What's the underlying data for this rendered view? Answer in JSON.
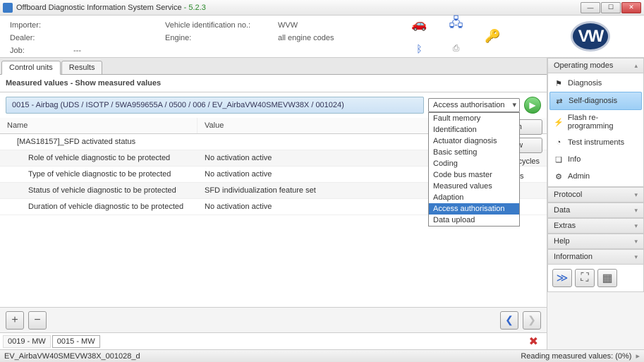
{
  "window": {
    "title": "Offboard Diagnostic Information System Service",
    "version": "- 5.2.3"
  },
  "header": {
    "importer_label": "Importer:",
    "importer_val": "",
    "dealer_label": "Dealer:",
    "dealer_val": "",
    "job_label": "Job:",
    "job_val": "---",
    "vin_label": "Vehicle identification no.:",
    "vin_val": "WVW",
    "engine_label": "Engine:",
    "engine_val": "all engine codes"
  },
  "tabs": {
    "t0": "Control units",
    "t1": "Results"
  },
  "section_title": "Measured values - Show measured values",
  "unit": "0015 - Airbag  (UDS / ISOTP / 5WA959655A / 0500 / 006 / EV_AirbaVW40SMEVW38X / 001024)",
  "dropdown": {
    "selected": "Access authorisation",
    "items": [
      "Fault memory",
      "Identification",
      "Actuator diagnosis",
      "Basic setting",
      "Coding",
      "Code bus master",
      "Measured values",
      "Adaption",
      "Access authorisation",
      "Data upload"
    ]
  },
  "columns": {
    "name": "Name",
    "value": "Value"
  },
  "rows": [
    {
      "name": "[MAS18157]_SFD activated status",
      "value": "",
      "indent": 1
    },
    {
      "name": "Role of vehicle diagnostic to be protected",
      "value": "No activation active",
      "indent": 2
    },
    {
      "name": "Type of vehicle diagnostic to be protected",
      "value": "No activation active",
      "indent": 2
    },
    {
      "name": "Status of vehicle diagnostic to be protected",
      "value": "SFD individualization feature set",
      "indent": 2
    },
    {
      "name": "Duration of vehicle diagnostic to be protected",
      "value": "No activation active",
      "indent": 2
    }
  ],
  "side_controls": {
    "refresh": "sh",
    "now": "ow",
    "cycles": "cycles",
    "cycles_val": "",
    "unit": "s"
  },
  "path": {
    "p0": "0019 - MW",
    "p1": "0015 - MW"
  },
  "status": {
    "left": "EV_AirbaVW40SMEVW38X_001028_d",
    "right": "Reading measured values: (0%)"
  },
  "sidebar": {
    "modes_title": "Operating modes",
    "modes": [
      {
        "label": "Diagnosis",
        "icon": "⚑",
        "state": "disabled"
      },
      {
        "label": "Self-diagnosis",
        "icon": "⇄",
        "state": "active"
      },
      {
        "label": "Flash re-programming",
        "icon": "⚡",
        "state": "disabled"
      },
      {
        "label": "Test instruments",
        "icon": "◔",
        "state": ""
      },
      {
        "label": "Info",
        "icon": "❏",
        "state": ""
      },
      {
        "label": "Admin",
        "icon": "⚙",
        "state": ""
      }
    ],
    "panels": [
      "Protocol",
      "Data",
      "Extras",
      "Help",
      "Information"
    ]
  }
}
